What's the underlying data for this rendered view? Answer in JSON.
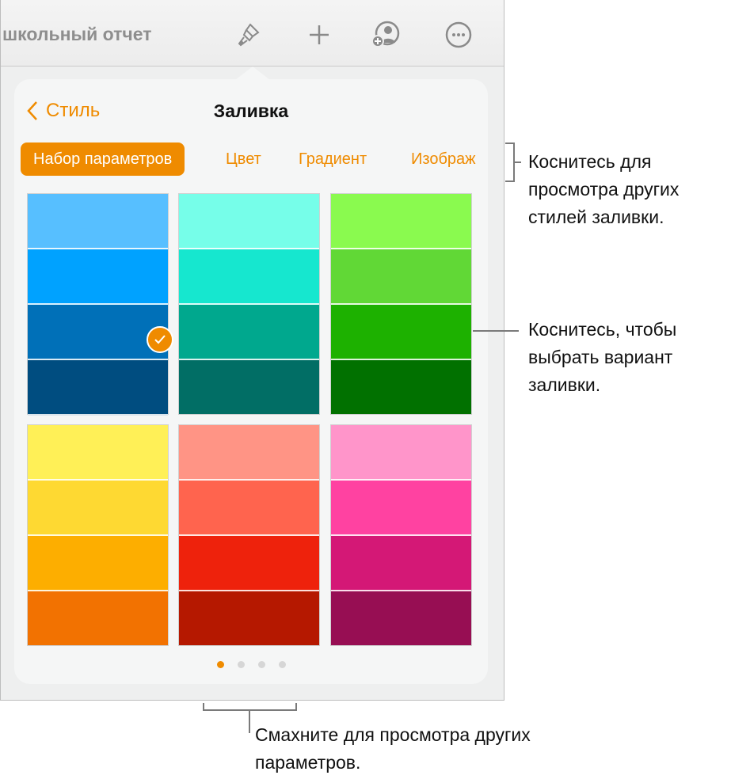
{
  "toolbar": {
    "doc_title": "школьный отчет"
  },
  "popover": {
    "back_label": "Стиль",
    "title": "Заливка",
    "tabs": [
      "Набор параметров",
      "Цвет",
      "Градиент",
      "Изображ"
    ],
    "selected": {
      "swatch": 0,
      "stripe": 2
    },
    "page": {
      "current": 1,
      "total": 4
    }
  },
  "swatches": [
    [
      "#57bfff",
      "#00a2ff",
      "#0070b8",
      "#004d80"
    ],
    [
      "#76fee9",
      "#16e7cf",
      "#00a88e",
      "#016e65"
    ],
    [
      "#8afa4f",
      "#61d836",
      "#1db100",
      "#017100"
    ],
    [
      "#fff057",
      "#fed932",
      "#fdae00",
      "#f27201"
    ],
    [
      "#ff9485",
      "#ff644e",
      "#ee220c",
      "#b51800"
    ],
    [
      "#ff95ca",
      "#ff42a1",
      "#d41876",
      "#970e53"
    ]
  ],
  "accent": "#ef8b00",
  "callouts": {
    "tabs": "Коснитесь для просмотра других стилей заливки.",
    "swatch": "Коснитесь, чтобы выбрать вариант заливки.",
    "dots": "Смахните для просмотра других параметров."
  }
}
